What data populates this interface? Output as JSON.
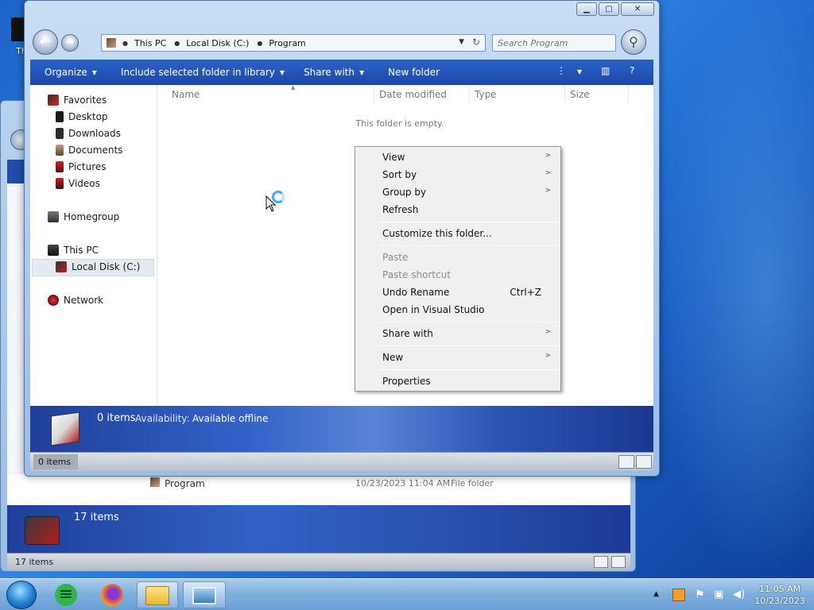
{
  "desktop": {
    "top_icon_label": "Th"
  },
  "background_window": {
    "row": {
      "name": "Program",
      "date_modified": "10/23/2023 11:04 AM",
      "type": "File folder"
    },
    "details_count": "17 items",
    "status_count": "17 items"
  },
  "window": {
    "caption": {
      "minimize": "▁",
      "maximize": "▢",
      "close": "✕"
    },
    "address": {
      "segments": [
        "This PC",
        "Local Disk (C:)",
        "Program"
      ]
    },
    "search": {
      "placeholder": "Search Program"
    },
    "commands": {
      "organize": "Organize",
      "include_library": "Include selected folder in library",
      "share_with": "Share with",
      "new_folder": "New folder"
    },
    "nav": {
      "favorites": "Favorites",
      "desktop": "Desktop",
      "downloads": "Downloads",
      "documents": "Documents",
      "pictures": "Pictures",
      "videos": "Videos",
      "homegroup": "Homegroup",
      "this_pc": "This PC",
      "local_disk": "Local Disk (C:)",
      "network": "Network"
    },
    "columns": {
      "name": "Name",
      "date_modified": "Date modified",
      "type": "Type",
      "size": "Size"
    },
    "empty_message": "This folder is empty.",
    "details": {
      "count": "0 items",
      "availability_label": "Availability:",
      "availability_value": "Available offline"
    },
    "status": {
      "count": "0 items"
    }
  },
  "context_menu": {
    "view": "View",
    "sort_by": "Sort by",
    "group_by": "Group by",
    "refresh": "Refresh",
    "customize": "Customize this folder...",
    "paste": "Paste",
    "paste_shortcut": "Paste shortcut",
    "undo_rename": "Undo Rename",
    "undo_shortcut": "Ctrl+Z",
    "open_vs": "Open in Visual Studio",
    "share_with": "Share with",
    "new": "New",
    "properties": "Properties"
  },
  "taskbar": {
    "time": "11:05 AM",
    "date": "10/23/2023"
  },
  "colors": {
    "command_bar": "#1d48a8",
    "details_pane": "#3363c8",
    "taskbar": "#7eaedd"
  }
}
